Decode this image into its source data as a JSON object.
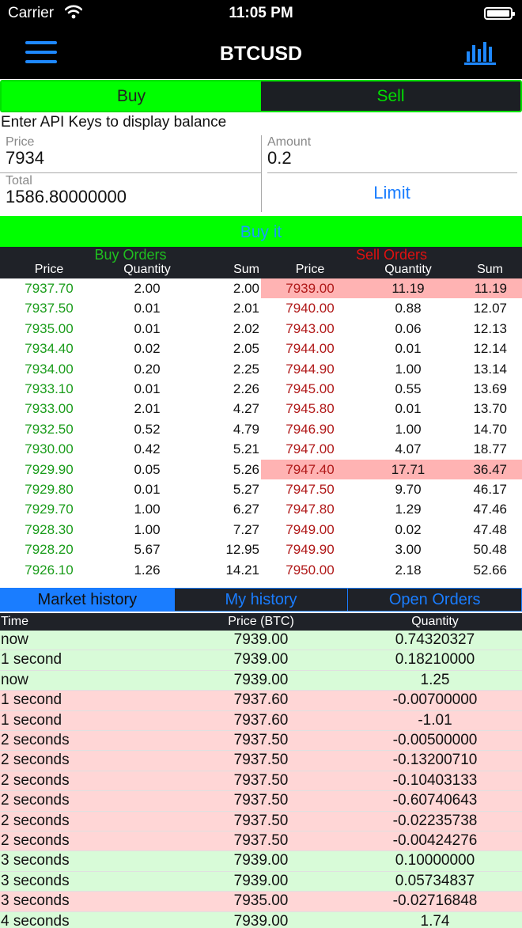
{
  "status_bar": {
    "carrier": "Carrier",
    "time": "11:05 PM"
  },
  "nav": {
    "title": "BTCUSD",
    "menu_icon": "hamburger-menu-icon",
    "chart_icon": "bar-chart-icon",
    "accent": "#1e88ff"
  },
  "trade_toggle": {
    "buy": "Buy",
    "sell": "Sell",
    "active": "Buy",
    "active_color": "#00ff00"
  },
  "order_form": {
    "api_message": "Enter API Keys to display balance",
    "price_label": "Price",
    "price_value": "7934",
    "amount_label": "Amount",
    "amount_value": "0.2",
    "total_label": "Total",
    "total_value": "1586.80000000",
    "limit_label": "Limit",
    "submit_label": "Buy it"
  },
  "order_book": {
    "buy_title": "Buy Orders",
    "sell_title": "Sell Orders",
    "columns": {
      "price": "Price",
      "quantity": "Quantity",
      "sum": "Sum"
    },
    "rows": [
      {
        "bp": "7937.70",
        "bq": "2.00",
        "bs": "2.00",
        "sp": "7939.00",
        "sq": "11.19",
        "ss": "11.19",
        "hl": true
      },
      {
        "bp": "7937.50",
        "bq": "0.01",
        "bs": "2.01",
        "sp": "7940.00",
        "sq": "0.88",
        "ss": "12.07",
        "hl": false
      },
      {
        "bp": "7935.00",
        "bq": "0.01",
        "bs": "2.02",
        "sp": "7943.00",
        "sq": "0.06",
        "ss": "12.13",
        "hl": false
      },
      {
        "bp": "7934.40",
        "bq": "0.02",
        "bs": "2.05",
        "sp": "7944.00",
        "sq": "0.01",
        "ss": "12.14",
        "hl": false
      },
      {
        "bp": "7934.00",
        "bq": "0.20",
        "bs": "2.25",
        "sp": "7944.90",
        "sq": "1.00",
        "ss": "13.14",
        "hl": false
      },
      {
        "bp": "7933.10",
        "bq": "0.01",
        "bs": "2.26",
        "sp": "7945.00",
        "sq": "0.55",
        "ss": "13.69",
        "hl": false
      },
      {
        "bp": "7933.00",
        "bq": "2.01",
        "bs": "4.27",
        "sp": "7945.80",
        "sq": "0.01",
        "ss": "13.70",
        "hl": false
      },
      {
        "bp": "7932.50",
        "bq": "0.52",
        "bs": "4.79",
        "sp": "7946.90",
        "sq": "1.00",
        "ss": "14.70",
        "hl": false
      },
      {
        "bp": "7930.00",
        "bq": "0.42",
        "bs": "5.21",
        "sp": "7947.00",
        "sq": "4.07",
        "ss": "18.77",
        "hl": false
      },
      {
        "bp": "7929.90",
        "bq": "0.05",
        "bs": "5.26",
        "sp": "7947.40",
        "sq": "17.71",
        "ss": "36.47",
        "hl": true
      },
      {
        "bp": "7929.80",
        "bq": "0.01",
        "bs": "5.27",
        "sp": "7947.50",
        "sq": "9.70",
        "ss": "46.17",
        "hl": false
      },
      {
        "bp": "7929.70",
        "bq": "1.00",
        "bs": "6.27",
        "sp": "7947.80",
        "sq": "1.29",
        "ss": "47.46",
        "hl": false
      },
      {
        "bp": "7928.30",
        "bq": "1.00",
        "bs": "7.27",
        "sp": "7949.00",
        "sq": "0.02",
        "ss": "47.48",
        "hl": false
      },
      {
        "bp": "7928.20",
        "bq": "5.67",
        "bs": "12.95",
        "sp": "7949.90",
        "sq": "3.00",
        "ss": "50.48",
        "hl": false
      },
      {
        "bp": "7926.10",
        "bq": "1.26",
        "bs": "14.21",
        "sp": "7950.00",
        "sq": "2.18",
        "ss": "52.66",
        "hl": false
      }
    ]
  },
  "history_tabs": {
    "market": "Market history",
    "mine": "My history",
    "open": "Open Orders",
    "active": "Market history"
  },
  "market_history": {
    "columns": {
      "time": "Time",
      "price": "Price (BTC)",
      "quantity": "Quantity"
    },
    "rows": [
      {
        "time": "now",
        "price": "7939.00",
        "qty": "0.74320327",
        "side": "buy"
      },
      {
        "time": "1 second",
        "price": "7939.00",
        "qty": "0.18210000",
        "side": "buy"
      },
      {
        "time": "now",
        "price": "7939.00",
        "qty": "1.25",
        "side": "buy"
      },
      {
        "time": "1 second",
        "price": "7937.60",
        "qty": "-0.00700000",
        "side": "sell"
      },
      {
        "time": "1 second",
        "price": "7937.60",
        "qty": "-1.01",
        "side": "sell"
      },
      {
        "time": "2 seconds",
        "price": "7937.50",
        "qty": "-0.00500000",
        "side": "sell"
      },
      {
        "time": "2 seconds",
        "price": "7937.50",
        "qty": "-0.13200710",
        "side": "sell"
      },
      {
        "time": "2 seconds",
        "price": "7937.50",
        "qty": "-0.10403133",
        "side": "sell"
      },
      {
        "time": "2 seconds",
        "price": "7937.50",
        "qty": "-0.60740643",
        "side": "sell"
      },
      {
        "time": "2 seconds",
        "price": "7937.50",
        "qty": "-0.02235738",
        "side": "sell"
      },
      {
        "time": "2 seconds",
        "price": "7937.50",
        "qty": "-0.00424276",
        "side": "sell"
      },
      {
        "time": "3 seconds",
        "price": "7939.00",
        "qty": "0.10000000",
        "side": "buy"
      },
      {
        "time": "3 seconds",
        "price": "7939.00",
        "qty": "0.05734837",
        "side": "buy"
      },
      {
        "time": "3 seconds",
        "price": "7935.00",
        "qty": "-0.02716848",
        "side": "sell"
      },
      {
        "time": "4 seconds",
        "price": "7939.00",
        "qty": "1.74",
        "side": "buy"
      }
    ]
  }
}
